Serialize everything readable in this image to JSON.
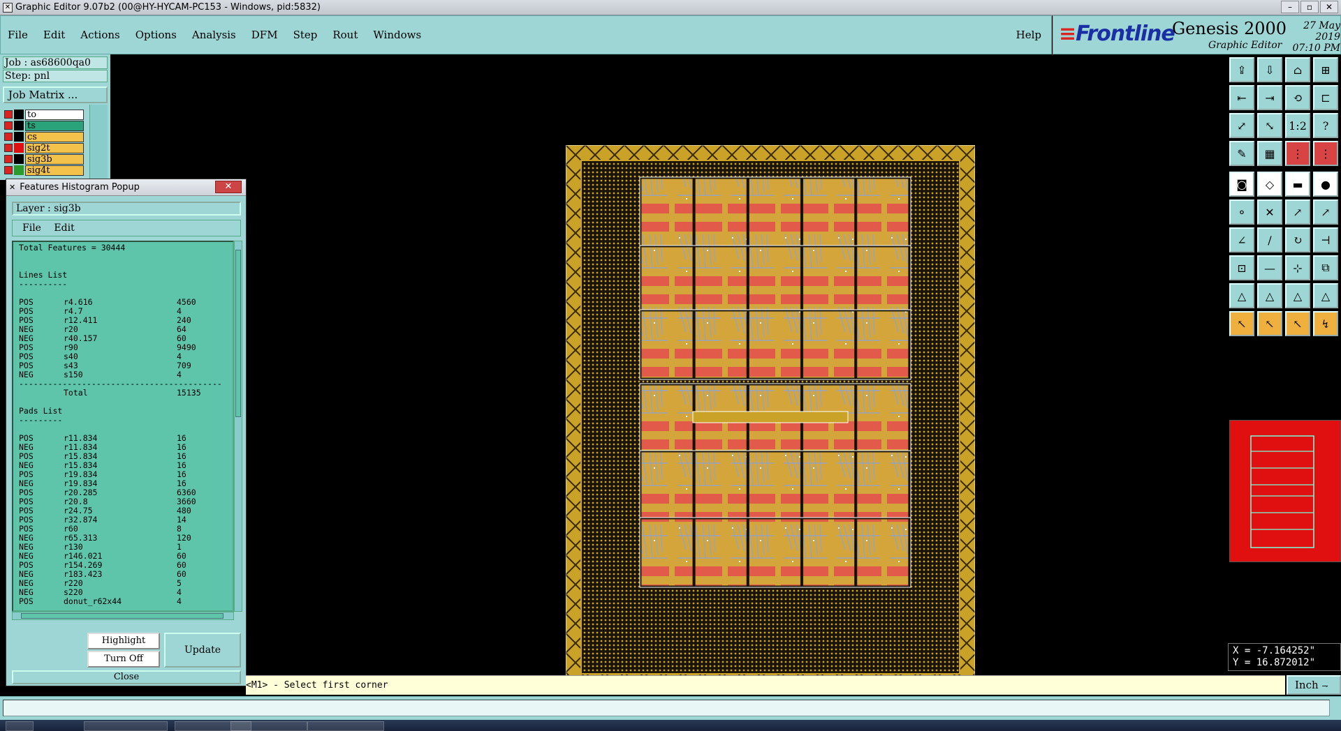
{
  "window": {
    "title": "Graphic Editor 9.07b2 (00@HY-HYCAM-PC153 - Windows, pid:5832)"
  },
  "menu": {
    "items": [
      "File",
      "Edit",
      "Actions",
      "Options",
      "Analysis",
      "DFM",
      "Step",
      "Rout",
      "Windows"
    ],
    "help": "Help"
  },
  "brand": {
    "logo": "Frontline",
    "product": "Genesis 2000",
    "subtitle": "Graphic Editor",
    "date": "27 May 2019",
    "time": "07:10 PM"
  },
  "job": {
    "job_label": "Job : as68600qa0",
    "step_label": "Step: pnl",
    "matrix_button": "Job Matrix ..."
  },
  "layers": [
    {
      "name": "to",
      "color": "#ffffff",
      "swatch": "#000000"
    },
    {
      "name": "ts",
      "color": "#2aa37a",
      "swatch": "#000000"
    },
    {
      "name": "cs",
      "color": "#f3c24a",
      "swatch": "#000000"
    },
    {
      "name": "sig2t",
      "color": "#f3c24a",
      "swatch": "#e01010"
    },
    {
      "name": "sig3b",
      "color": "#f3c24a",
      "swatch": "#000000"
    },
    {
      "name": "sig4t",
      "color": "#f3c24a",
      "swatch": "#2c9a2c"
    }
  ],
  "popup": {
    "title": "Features Histogram Popup",
    "layer_label": "Layer :  sig3b",
    "menu": [
      "File",
      "Edit"
    ],
    "total_features": "Total Features = 30444",
    "lines_header": "Lines List",
    "underline": "----------",
    "lines": [
      [
        "POS",
        "r4.616",
        "4560"
      ],
      [
        "POS",
        "r4.7",
        "4"
      ],
      [
        "POS",
        "r12.411",
        "240"
      ],
      [
        "NEG",
        "r20",
        "64"
      ],
      [
        "NEG",
        "r40.157",
        "60"
      ],
      [
        "POS",
        "r90",
        "9490"
      ],
      [
        "POS",
        "s40",
        "4"
      ],
      [
        "POS",
        "s43",
        "709"
      ],
      [
        "NEG",
        "s150",
        "4"
      ]
    ],
    "separator": "------------------------------------------",
    "lines_total_label": "Total",
    "lines_total_value": "15135",
    "pads_header": "Pads List",
    "pads": [
      [
        "POS",
        "r11.834",
        "16"
      ],
      [
        "NEG",
        "r11.834",
        "16"
      ],
      [
        "POS",
        "r15.834",
        "16"
      ],
      [
        "NEG",
        "r15.834",
        "16"
      ],
      [
        "POS",
        "r19.834",
        "16"
      ],
      [
        "NEG",
        "r19.834",
        "16"
      ],
      [
        "POS",
        "r20.285",
        "6360"
      ],
      [
        "POS",
        "r20.8",
        "3660"
      ],
      [
        "POS",
        "r24.75",
        "480"
      ],
      [
        "POS",
        "r32.874",
        "14"
      ],
      [
        "POS",
        "r60",
        "8"
      ],
      [
        "NEG",
        "r65.313",
        "120"
      ],
      [
        "NEG",
        "r130",
        "1"
      ],
      [
        "NEG",
        "r146.021",
        "60"
      ],
      [
        "POS",
        "r154.269",
        "60"
      ],
      [
        "NEG",
        "r183.423",
        "60"
      ],
      [
        "NEG",
        "r220",
        "5"
      ],
      [
        "NEG",
        "s220",
        "4"
      ],
      [
        "POS",
        "donut_r62x44",
        "4"
      ]
    ],
    "highlight_button": "Highlight",
    "turnoff_button": "Turn Off",
    "update_button": "Update",
    "close_button": "Close"
  },
  "coords": {
    "x": "X = -7.164252\"",
    "y": "Y = 16.872012\""
  },
  "prompt": "<M1> - Select first corner",
  "unit": "Inch",
  "colors": {
    "panel": "#9ed6d6",
    "list_bg": "#5ec4aa",
    "board": "#c9a227",
    "overview": "#e01010"
  }
}
